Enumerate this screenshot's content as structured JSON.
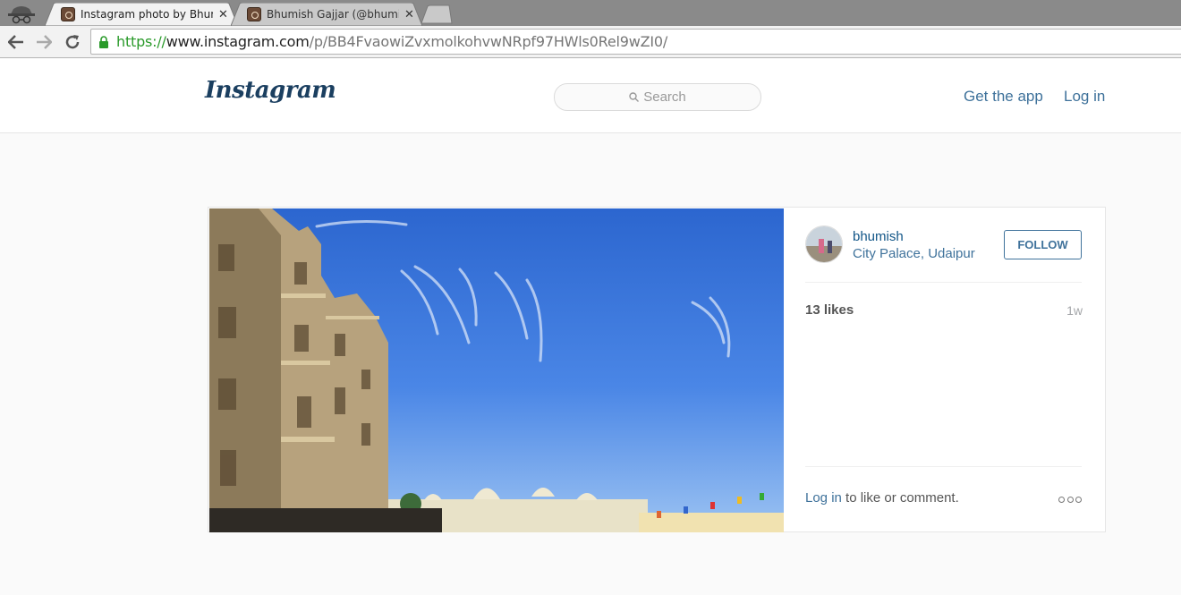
{
  "browser": {
    "tabs": [
      {
        "title": "Instagram photo by Bhum",
        "active": true
      },
      {
        "title": "Bhumish Gajjar (@bhumist",
        "active": false
      }
    ],
    "url": {
      "scheme": "https://",
      "host": "www.instagram.com",
      "path": "/p/BB4FvaowiZvxmolkohvwNRpf97HWls0Rel9wZI0/"
    }
  },
  "header": {
    "logo": "Instagram",
    "search_placeholder": "Search",
    "get_app": "Get the app",
    "login": "Log in"
  },
  "post": {
    "username": "bhumish",
    "location": "City Palace, Udaipur",
    "follow_label": "FOLLOW",
    "likes": "13 likes",
    "time": "1w",
    "login_link": "Log in",
    "comment_prompt": " to like or comment."
  },
  "colors": {
    "link": "#3f729b",
    "username": "#125688",
    "sky": "#3f7ae0"
  }
}
